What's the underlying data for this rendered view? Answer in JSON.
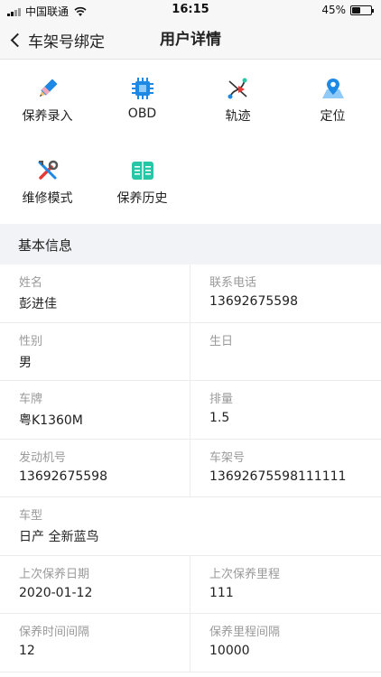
{
  "status_bar": {
    "carrier": "中国联通",
    "time": "16:15",
    "battery": "45%",
    "battery_level": 0.45
  },
  "nav": {
    "back_label": "车架号绑定",
    "title": "用户详情"
  },
  "actions": [
    {
      "label": "保养录入",
      "icon": "pencil-icon"
    },
    {
      "label": "OBD",
      "icon": "chip-icon"
    },
    {
      "label": "轨迹",
      "icon": "route-icon"
    },
    {
      "label": "定位",
      "icon": "map-pin-icon"
    },
    {
      "label": "维修模式",
      "icon": "tools-icon"
    },
    {
      "label": "保养历史",
      "icon": "book-icon"
    }
  ],
  "section": {
    "title": "基本信息"
  },
  "fields": {
    "name": {
      "label": "姓名",
      "value": "彭进佳"
    },
    "phone": {
      "label": "联系电话",
      "value": "13692675598"
    },
    "gender": {
      "label": "性别",
      "value": "男"
    },
    "birthday": {
      "label": "生日",
      "value": ""
    },
    "plate": {
      "label": "车牌",
      "value": "粤K1360M"
    },
    "displacement": {
      "label": "排量",
      "value": "1.5"
    },
    "engine_no": {
      "label": "发动机号",
      "value": "13692675598"
    },
    "vin": {
      "label": "车架号",
      "value": "13692675598111111"
    },
    "model": {
      "label": "车型",
      "value": "日产 全新蓝鸟"
    },
    "last_service_date": {
      "label": "上次保养日期",
      "value": "2020-01-12"
    },
    "last_service_mileage": {
      "label": "上次保养里程",
      "value": "111"
    },
    "service_interval_time": {
      "label": "保养时间间隔",
      "value": "12"
    },
    "service_interval_mileage": {
      "label": "保养里程间隔",
      "value": "10000"
    }
  },
  "colors": {
    "accent_blue": "#1e88e5",
    "accent_teal": "#26c6a6",
    "accent_red": "#e53935",
    "section_bg": "#f2f3f7"
  }
}
